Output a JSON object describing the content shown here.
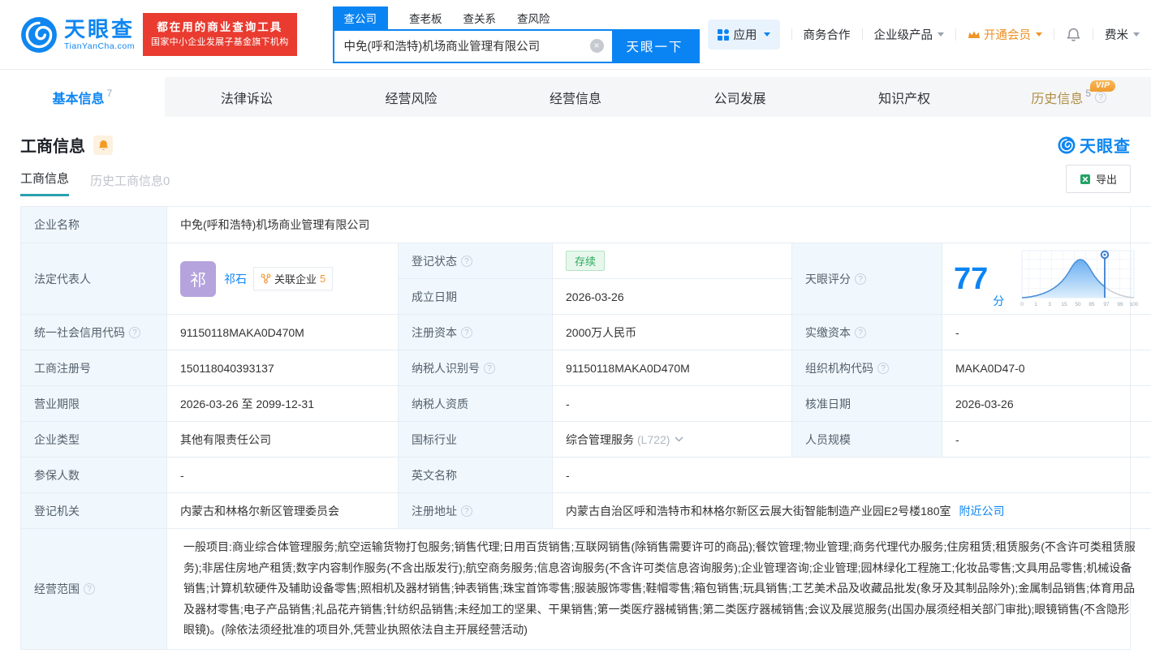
{
  "header": {
    "brand": "天眼查",
    "brand_domain": "TianYanCha.com",
    "slogan_line1": "都在用的商业查询工具",
    "slogan_line2": "国家中小企业发展子基金旗下机构",
    "search_tabs": [
      {
        "label": "查公司",
        "active": true
      },
      {
        "label": "查老板",
        "active": false
      },
      {
        "label": "查关系",
        "active": false
      },
      {
        "label": "查风险",
        "active": false
      }
    ],
    "search_value": "中免(呼和浩特)机场商业管理有限公司",
    "search_button": "天眼一下",
    "nav_apps": "应用",
    "nav_coop": "商务合作",
    "nav_enterprise": "企业级产品",
    "nav_vip": "开通会员",
    "nav_user": "费米"
  },
  "main_tabs": [
    {
      "label": "基本信息",
      "count": "7",
      "active": true
    },
    {
      "label": "法律诉讼"
    },
    {
      "label": "经营风险"
    },
    {
      "label": "经营信息"
    },
    {
      "label": "公司发展"
    },
    {
      "label": "知识产权"
    },
    {
      "label": "历史信息",
      "count": "5",
      "badge": "VIP"
    }
  ],
  "section": {
    "title": "工商信息",
    "watermark": "天眼查",
    "subtab_active": "工商信息",
    "subtab_history": "历史工商信息0",
    "export_button": "导出"
  },
  "score": {
    "label": "天眼评分",
    "value": "77",
    "unit": "分",
    "axis_ticks": [
      "0",
      "1",
      "3",
      "15",
      "50",
      "85",
      "97",
      "99",
      "100"
    ]
  },
  "company": {
    "name_label": "企业名称",
    "name": "中免(呼和浩特)机场商业管理有限公司",
    "legal_rep_label": "法定代表人",
    "legal_rep_avatar": "祁",
    "legal_rep_name": "祁石",
    "related_company_label": "关联企业",
    "related_company_count": "5",
    "reg_status_label": "登记状态",
    "reg_status": "存续",
    "establish_date_label": "成立日期",
    "establish_date": "2026-03-26",
    "uscc_label": "统一社会信用代码",
    "uscc": "91150118MAKA0D470M",
    "reg_capital_label": "注册资本",
    "reg_capital": "2000万人民币",
    "paid_capital_label": "实缴资本",
    "paid_capital": "-",
    "reg_no_label": "工商注册号",
    "reg_no": "150118040393137",
    "taxpayer_id_label": "纳税人识别号",
    "taxpayer_id": "91150118MAKA0D470M",
    "org_code_label": "组织机构代码",
    "org_code": "MAKA0D47-0",
    "business_term_label": "营业期限",
    "business_term": "2026-03-26 至 2099-12-31",
    "taxpayer_qual_label": "纳税人资质",
    "taxpayer_qual": "-",
    "approval_date_label": "核准日期",
    "approval_date": "2026-03-26",
    "company_type_label": "企业类型",
    "company_type": "其他有限责任公司",
    "industry_label": "国标行业",
    "industry": "综合管理服务",
    "industry_code": "(L722)",
    "staff_size_label": "人员规模",
    "staff_size": "-",
    "insured_count_label": "参保人数",
    "insured_count": "-",
    "english_name_label": "英文名称",
    "english_name": "-",
    "reg_authority_label": "登记机关",
    "reg_authority": "内蒙古和林格尔新区管理委员会",
    "reg_address_label": "注册地址",
    "reg_address": "内蒙古自治区呼和浩特市和林格尔新区云展大街智能制造产业园E2号楼180室",
    "nearby_link": "附近公司",
    "business_scope_label": "经营范围",
    "business_scope": "一般项目:商业综合体管理服务;航空运输货物打包服务;销售代理;日用百货销售;互联网销售(除销售需要许可的商品);餐饮管理;物业管理;商务代理代办服务;住房租赁;租赁服务(不含许可类租赁服务);非居住房地产租赁;数字内容制作服务(不含出版发行);航空商务服务;信息咨询服务(不含许可类信息咨询服务);企业管理咨询;企业管理;园林绿化工程施工;化妆品零售;文具用品零售;机械设备销售;计算机软硬件及辅助设备零售;照相机及器材销售;钟表销售;珠宝首饰零售;服装服饰零售;鞋帽零售;箱包销售;玩具销售;工艺美术品及收藏品批发(象牙及其制品除外);金属制品销售;体育用品及器材零售;电子产品销售;礼品花卉销售;针纺织品销售;未经加工的坚果、干果销售;第一类医疗器械销售;第二类医疗器械销售;会议及展览服务(出国办展须经相关部门审批);眼镜销售(不含隐形眼镜)。(除依法须经批准的项目外,凭营业执照依法自主开展经营活动)"
  },
  "icons": {
    "clear": "×",
    "question": "?"
  },
  "colors": {
    "brand_blue": "#0B84F3",
    "banner_red": "#E93B30",
    "vip_gold": "#B08E46",
    "status_green": "#2CAB5C",
    "member_orange": "#EF9426",
    "avatar_purple": "#B5A3DD"
  }
}
